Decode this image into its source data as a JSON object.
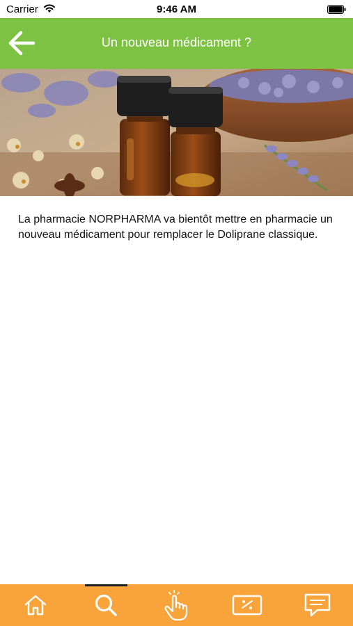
{
  "status_bar": {
    "carrier": "Carrier",
    "time": "9:46 AM"
  },
  "header": {
    "title": "Un nouveau médicament ?",
    "background_color": "#7dc242",
    "back_icon": "arrow-left-icon"
  },
  "hero": {
    "icon": "essential-oil-bottles-lavender-photo"
  },
  "article": {
    "body": "La pharmacie NORPHARMA va bientôt mettre en pharmacie un nouveau médicament pour remplacer le Doliprane classique."
  },
  "tab_bar": {
    "background_color": "#f8a43a",
    "active_tab": "search",
    "tabs": [
      {
        "id": "home",
        "icon": "home-icon"
      },
      {
        "id": "search",
        "icon": "search-icon"
      },
      {
        "id": "tap",
        "icon": "hand-tap-icon"
      },
      {
        "id": "promo",
        "icon": "coupon-percent-icon"
      },
      {
        "id": "messages",
        "icon": "message-icon"
      }
    ]
  }
}
